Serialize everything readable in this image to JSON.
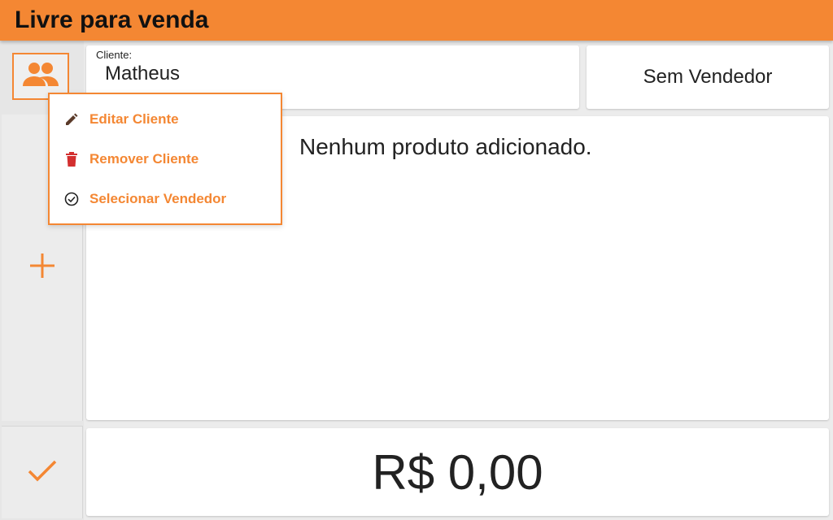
{
  "header": {
    "title": "Livre para venda"
  },
  "client": {
    "label": "Cliente:",
    "name": "Matheus",
    "icon": "group-icon"
  },
  "seller": {
    "label": "Sem Vendedor"
  },
  "products": {
    "empty_message": "Nenhum produto adicionado."
  },
  "total": {
    "value": "R$ 0,00"
  },
  "actions": {
    "add_icon": "plus-icon",
    "confirm_icon": "check-icon"
  },
  "menu": {
    "items": [
      {
        "label": "Editar Cliente",
        "icon": "pencil-icon"
      },
      {
        "label": "Remover Cliente",
        "icon": "trash-icon"
      },
      {
        "label": "Selecionar Vendedor",
        "icon": "check-circle-icon"
      }
    ]
  },
  "colors": {
    "accent": "#f48733",
    "danger": "#d32f2f",
    "background": "#ececec"
  }
}
